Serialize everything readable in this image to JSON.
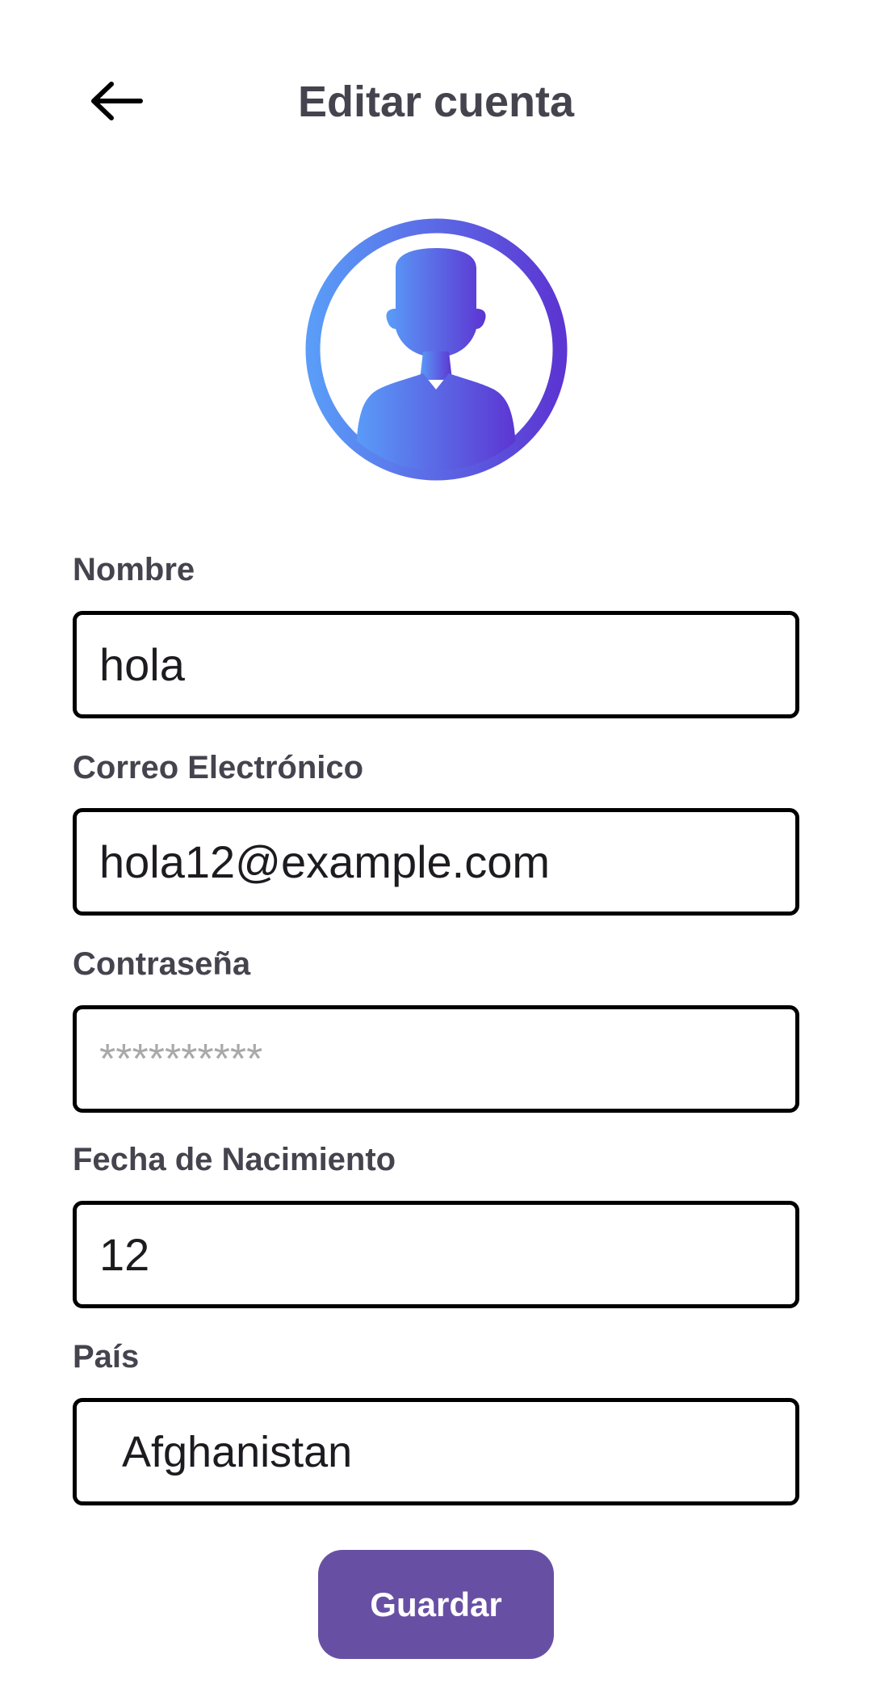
{
  "header": {
    "title": "Editar cuenta",
    "back_icon": "arrow-left-icon"
  },
  "avatar": {
    "icon": "user-avatar-icon",
    "gradient_start": "#5a9cf8",
    "gradient_end": "#5c35d2"
  },
  "form": {
    "nombre": {
      "label": "Nombre",
      "value": "hola"
    },
    "correo": {
      "label": "Correo Electrónico",
      "value": "hola12@example.com"
    },
    "contrasena": {
      "label": "Contraseña",
      "placeholder": "**********"
    },
    "fecha": {
      "label": "Fecha de Nacimiento",
      "value": "12"
    },
    "pais": {
      "label": "País",
      "value": "Afghanistan"
    }
  },
  "save_button": {
    "label": "Guardar",
    "color": "#6750a4"
  },
  "colors": {
    "label_text": "#45444e",
    "field_border": "#000000",
    "placeholder": "#a9a9a9"
  }
}
